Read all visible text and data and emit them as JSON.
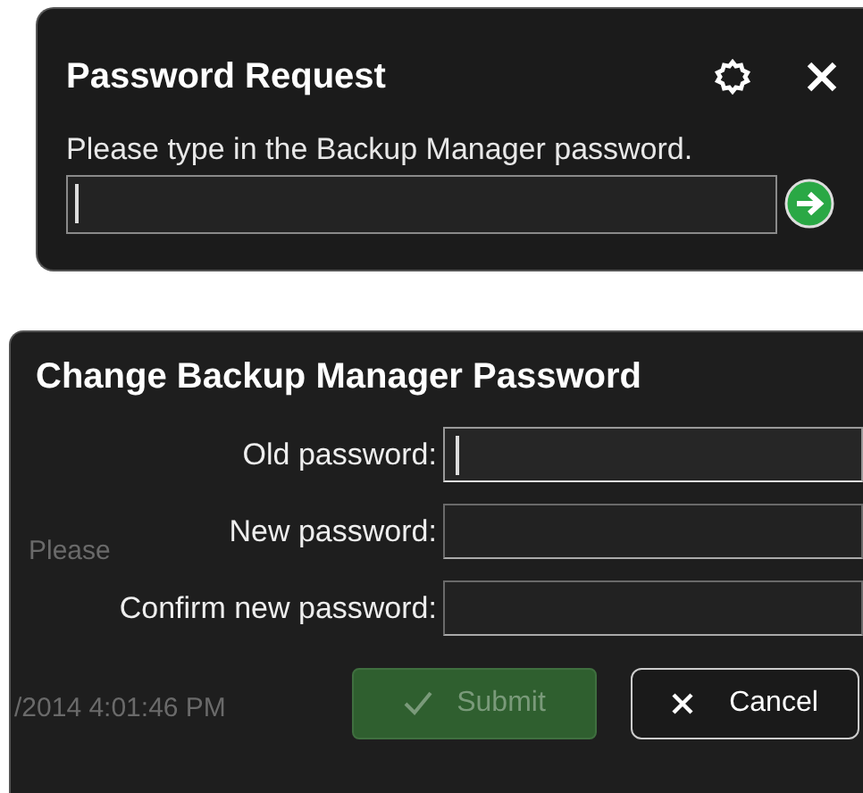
{
  "password_request": {
    "title": "Password Request",
    "prompt": "Please type in the Backup Manager password.",
    "field": {
      "focused": true
    }
  },
  "change_password": {
    "title": "Change Backup Manager Password",
    "background_texts": [
      "Please",
      "/2014 4:01:46 PM"
    ],
    "fields": [
      {
        "label": "Old password:",
        "focused": true
      },
      {
        "label": "New password:",
        "focused": false
      },
      {
        "label": "Confirm new password:",
        "focused": false
      }
    ],
    "buttons": [
      {
        "kind": "submit",
        "label": "Submit",
        "disabled": true
      },
      {
        "kind": "cancel",
        "label": "Cancel",
        "disabled": false
      }
    ]
  }
}
